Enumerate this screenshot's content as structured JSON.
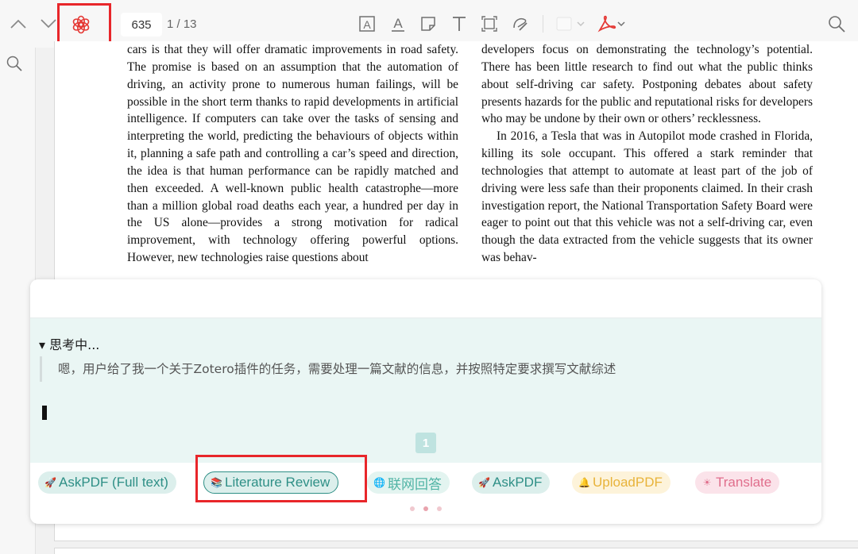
{
  "toolbar": {
    "page_number": "635",
    "page_count": "1 / 13",
    "icons": [
      "chevron-up-icon",
      "chevron-down-icon",
      "openai-logo-icon",
      "text-box-icon",
      "underline-icon",
      "note-icon",
      "text-icon",
      "area-select-icon",
      "ink-icon",
      "color-swatch-icon",
      "pdf-icon",
      "search-icon"
    ],
    "highlight_color": "#e8262a"
  },
  "document": {
    "left_column": "cars is that they will offer dramatic improvements in road safety. The promise is based on an assumption that the automation of driving, an activity prone to numerous human failings, will be possible in the short term thanks to rapid developments in artificial intelligence. If computers can take over the tasks of sensing and interpreting the world, predicting the behaviours of objects within it, planning a safe path and controlling a car’s speed and direction, the idea is that human performance can be rapidly matched and then exceeded. A well-known public health catastrophe—more than a million global road deaths each year, a hundred per day in the US alone—provides a strong motivation for radical improvement, with technology offering powerful options. However, new technologies raise questions about",
    "right_column_p1": "developers focus on demonstrating the technology’s potential. There has been little research to find out what the public thinks about self-driving car safety. Postponing debates about safety presents hazards for the public and reputational risks for developers who may be undone by their own or others’ recklessness.",
    "right_column_p2": "In 2016, a Tesla that was in Autopilot mode crashed in Florida, killing its sole occupant. This offered a stark reminder that technologies that attempt to automate at least part of the job of driving were less safe than their proponents claimed. In their crash investigation report, the National Transportation Safety Board were eager to point out that this vehicle was not a self-driving car, even though the data extracted from the vehicle suggests that its owner was behav-"
  },
  "panel": {
    "thinking_title": "▾ 思考中...",
    "thinking_text": "嗯，用户给了我一个关于Zotero插件的任务，需要处理一篇文献的信息，并按照特定要求撰写文献综述",
    "page_badge": "1",
    "chips": [
      {
        "label": "AskPDF (Full text)",
        "icon": "rocket-icon"
      },
      {
        "label": "Literature Review",
        "icon": "books-icon"
      },
      {
        "label": "联网回答",
        "icon": "globe-icon"
      },
      {
        "label": "AskPDF",
        "icon": "rocket-icon"
      },
      {
        "label": "UploadPDF",
        "icon": "bell-icon"
      },
      {
        "label": "Translate",
        "icon": "sun-icon"
      }
    ],
    "accent_color": "#2e8f86"
  }
}
